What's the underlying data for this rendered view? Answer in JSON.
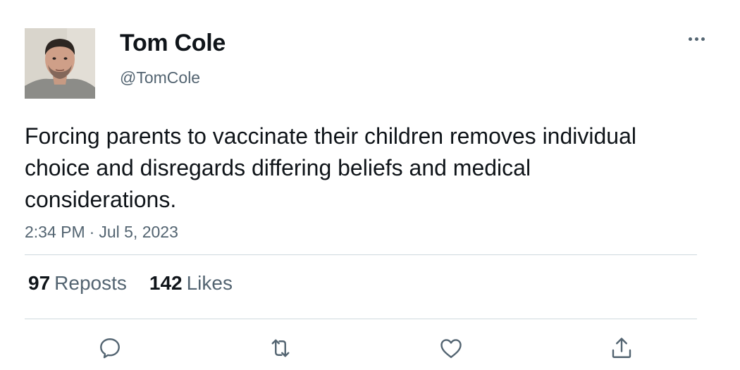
{
  "tweet": {
    "author_name": "Tom Cole",
    "handle": "@TomCole",
    "text": "Forcing parents to vaccinate their children removes individual choice and disregards differing beliefs and medical considerations.",
    "time": "2:34 PM",
    "separator": "·",
    "date": "Jul 5, 2023"
  },
  "stats": {
    "reposts_count": "97",
    "reposts_label": "Reposts",
    "likes_count": "142",
    "likes_label": "Likes"
  },
  "actions": [
    "reply-icon",
    "repost-icon",
    "like-icon",
    "share-icon"
  ],
  "colors": {
    "text": "#0f1419",
    "secondary": "#536471",
    "divider": "#cfd9de",
    "avatar_background": "#d8d4cc"
  }
}
